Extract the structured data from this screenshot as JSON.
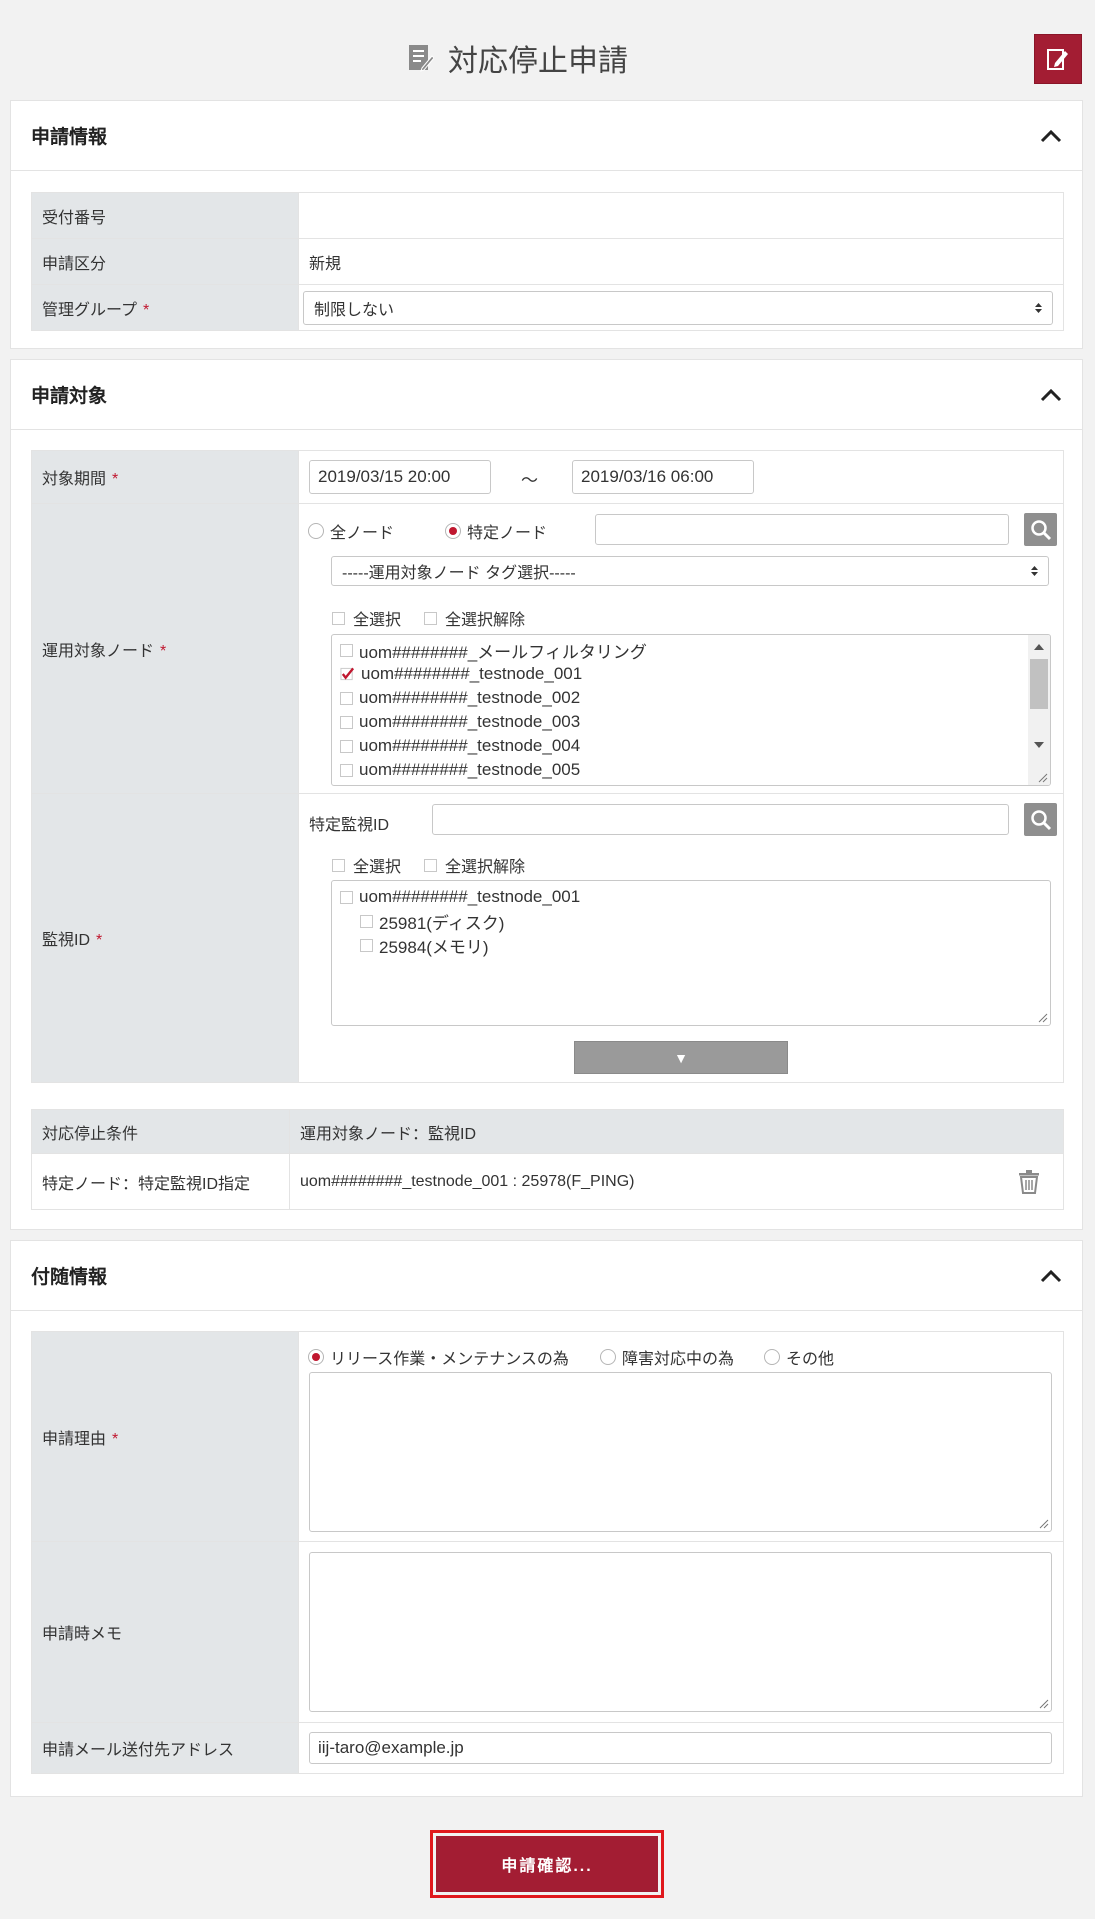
{
  "page": {
    "title": "対応停止申請"
  },
  "section_info": {
    "title": "申請情報",
    "rows": [
      {
        "label": "受付番号",
        "value": ""
      },
      {
        "label": "申請区分",
        "value": "新規"
      },
      {
        "label": "管理グループ",
        "required": "*",
        "value": "制限しない"
      }
    ]
  },
  "section_target": {
    "title": "申請対象",
    "period": {
      "label": "対象期間",
      "required": "*",
      "start": "2019/03/15 20:00",
      "separator": "～",
      "end": "2019/03/16 06:00"
    },
    "nodes": {
      "label": "運用対象ノード",
      "required": "*",
      "radio_all": "全ノード",
      "radio_specific": "特定ノード",
      "selected_radio": "特定ノード",
      "search_value": "",
      "tag_select": "-----運用対象ノード タグ選択-----",
      "select_all": "全選択",
      "deselect_all": "全選択解除",
      "items": [
        {
          "label": "uom########_メールフィルタリング",
          "checked": false
        },
        {
          "label": "uom########_testnode_001",
          "checked": true
        },
        {
          "label": "uom########_testnode_002",
          "checked": false
        },
        {
          "label": "uom########_testnode_003",
          "checked": false
        },
        {
          "label": "uom########_testnode_004",
          "checked": false
        },
        {
          "label": "uom########_testnode_005",
          "checked": false
        }
      ]
    },
    "monitor": {
      "label": "監視ID",
      "required": "*",
      "search_label": "特定監視ID",
      "search_value": "",
      "select_all": "全選択",
      "deselect_all": "全選択解除",
      "tree": [
        {
          "label": "uom########_testnode_001",
          "level": 0
        },
        {
          "label": "25981(ディスク)",
          "level": 1
        },
        {
          "label": "25984(メモリ)",
          "level": 1
        }
      ],
      "add_button": "▼"
    },
    "conditions": {
      "headers": [
        "対応停止条件",
        "運用対象ノード：監視ID"
      ],
      "rows": [
        {
          "condition": "特定ノード：特定監視ID指定",
          "target": "uom########_testnode_001 : 25978(F_PING)"
        }
      ]
    }
  },
  "section_extra": {
    "title": "付随情報",
    "reason": {
      "label": "申請理由",
      "required": "*",
      "options": [
        "リリース作業・メンテナンスの為",
        "障害対応中の為",
        "その他"
      ],
      "selected": "リリース作業・メンテナンスの為",
      "value": ""
    },
    "memo": {
      "label": "申請時メモ",
      "value": ""
    },
    "email": {
      "label": "申請メール送付先アドレス",
      "value": "iij-taro@example.jp"
    }
  },
  "submit": {
    "label": "申請確認..."
  },
  "colors": {
    "accent": "#a31d33",
    "required": "#c0172f",
    "label_bg": "#e3e6e8",
    "highlight": "#e0181d"
  }
}
